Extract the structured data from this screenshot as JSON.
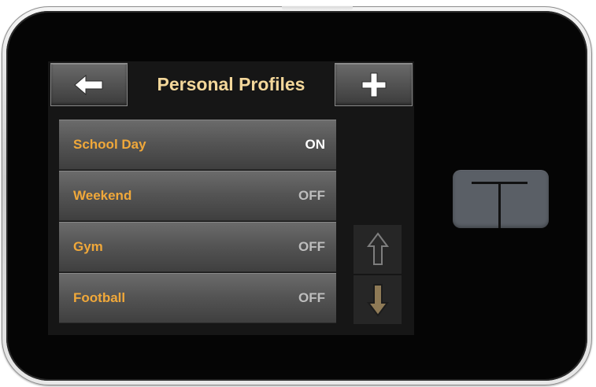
{
  "screen": {
    "title": "Personal Profiles"
  },
  "header": {
    "back_icon": "left-arrow-icon",
    "add_icon": "plus-icon"
  },
  "profiles": [
    {
      "name": "School Day",
      "state": "ON"
    },
    {
      "name": "Weekend",
      "state": "OFF"
    },
    {
      "name": "Gym",
      "state": "OFF"
    },
    {
      "name": "Football",
      "state": "OFF"
    }
  ],
  "scroll": {
    "up_icon": "up-arrow-icon",
    "down_icon": "down-arrow-icon",
    "up_color": "#7e7e7e",
    "down_color": "#8e7a56"
  },
  "device": {
    "home_icon": "t-logo-icon"
  },
  "colors": {
    "title": "#f3d79a",
    "profile_label": "#f0a83a",
    "state_on": "#ffffff",
    "state_off": "#bdbdbd"
  }
}
